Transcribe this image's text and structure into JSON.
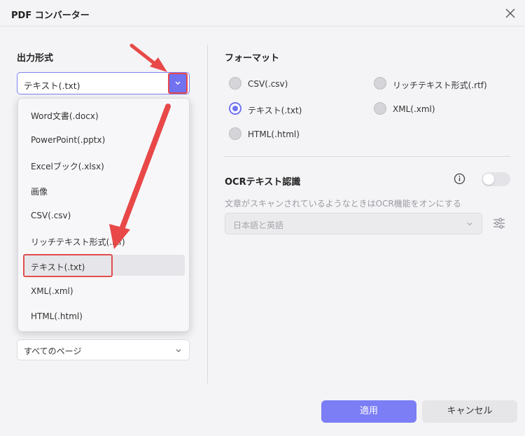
{
  "window": {
    "title": "PDF コンバーター"
  },
  "output_format": {
    "label": "出力形式",
    "selected": "テキスト(.txt)",
    "menu_items": [
      "Word文書(.docx)",
      "PowerPoint(.pptx)",
      "Excelブック(.xlsx)",
      "画像",
      "CSV(.csv)",
      "リッチテキスト形式(.rtf)",
      "テキスト(.txt)",
      "XML(.xml)",
      "HTML(.html)"
    ],
    "page_range": "すべてのページ"
  },
  "format": {
    "label": "フォーマット",
    "options": [
      {
        "label": "CSV(.csv)",
        "checked": false
      },
      {
        "label": "リッチテキスト形式(.rtf)",
        "checked": false
      },
      {
        "label": "テキスト(.txt)",
        "checked": true
      },
      {
        "label": "XML(.xml)",
        "checked": false
      },
      {
        "label": "HTML(.html)",
        "checked": false
      }
    ]
  },
  "ocr": {
    "label": "OCRテキスト認識",
    "enabled": false,
    "description": "文章がスキャンされているようなときはOCR機能をオンにする",
    "language": "日本語と英語"
  },
  "buttons": {
    "apply": "適用",
    "cancel": "キャンセル"
  },
  "colors": {
    "accent": "#7b7ef5",
    "annotation": "#e84848"
  },
  "icons": [
    "close-icon",
    "chevron-down-icon",
    "info-icon",
    "sliders-icon"
  ]
}
